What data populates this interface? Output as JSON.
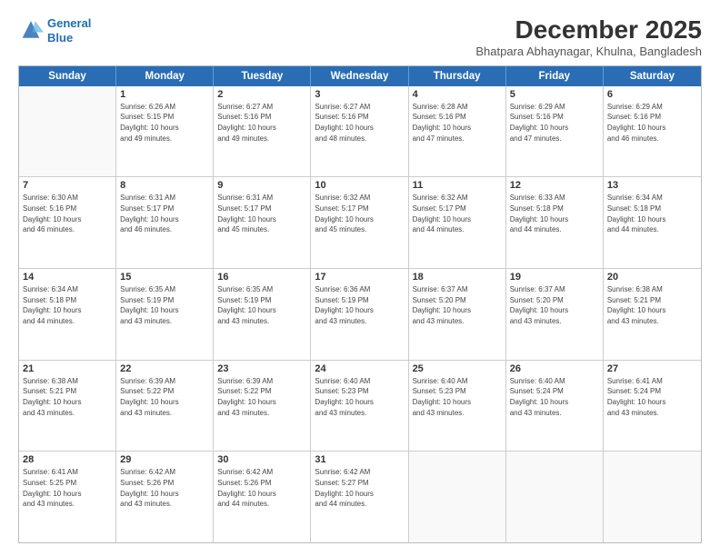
{
  "logo": {
    "line1": "General",
    "line2": "Blue"
  },
  "title": "December 2025",
  "location": "Bhatpara Abhaynagar, Khulna, Bangladesh",
  "weekdays": [
    "Sunday",
    "Monday",
    "Tuesday",
    "Wednesday",
    "Thursday",
    "Friday",
    "Saturday"
  ],
  "weeks": [
    [
      {
        "day": "",
        "info": ""
      },
      {
        "day": "1",
        "info": "Sunrise: 6:26 AM\nSunset: 5:15 PM\nDaylight: 10 hours\nand 49 minutes."
      },
      {
        "day": "2",
        "info": "Sunrise: 6:27 AM\nSunset: 5:16 PM\nDaylight: 10 hours\nand 49 minutes."
      },
      {
        "day": "3",
        "info": "Sunrise: 6:27 AM\nSunset: 5:16 PM\nDaylight: 10 hours\nand 48 minutes."
      },
      {
        "day": "4",
        "info": "Sunrise: 6:28 AM\nSunset: 5:16 PM\nDaylight: 10 hours\nand 47 minutes."
      },
      {
        "day": "5",
        "info": "Sunrise: 6:29 AM\nSunset: 5:16 PM\nDaylight: 10 hours\nand 47 minutes."
      },
      {
        "day": "6",
        "info": "Sunrise: 6:29 AM\nSunset: 5:16 PM\nDaylight: 10 hours\nand 46 minutes."
      }
    ],
    [
      {
        "day": "7",
        "info": "Sunrise: 6:30 AM\nSunset: 5:16 PM\nDaylight: 10 hours\nand 46 minutes."
      },
      {
        "day": "8",
        "info": "Sunrise: 6:31 AM\nSunset: 5:17 PM\nDaylight: 10 hours\nand 46 minutes."
      },
      {
        "day": "9",
        "info": "Sunrise: 6:31 AM\nSunset: 5:17 PM\nDaylight: 10 hours\nand 45 minutes."
      },
      {
        "day": "10",
        "info": "Sunrise: 6:32 AM\nSunset: 5:17 PM\nDaylight: 10 hours\nand 45 minutes."
      },
      {
        "day": "11",
        "info": "Sunrise: 6:32 AM\nSunset: 5:17 PM\nDaylight: 10 hours\nand 44 minutes."
      },
      {
        "day": "12",
        "info": "Sunrise: 6:33 AM\nSunset: 5:18 PM\nDaylight: 10 hours\nand 44 minutes."
      },
      {
        "day": "13",
        "info": "Sunrise: 6:34 AM\nSunset: 5:18 PM\nDaylight: 10 hours\nand 44 minutes."
      }
    ],
    [
      {
        "day": "14",
        "info": "Sunrise: 6:34 AM\nSunset: 5:18 PM\nDaylight: 10 hours\nand 44 minutes."
      },
      {
        "day": "15",
        "info": "Sunrise: 6:35 AM\nSunset: 5:19 PM\nDaylight: 10 hours\nand 43 minutes."
      },
      {
        "day": "16",
        "info": "Sunrise: 6:35 AM\nSunset: 5:19 PM\nDaylight: 10 hours\nand 43 minutes."
      },
      {
        "day": "17",
        "info": "Sunrise: 6:36 AM\nSunset: 5:19 PM\nDaylight: 10 hours\nand 43 minutes."
      },
      {
        "day": "18",
        "info": "Sunrise: 6:37 AM\nSunset: 5:20 PM\nDaylight: 10 hours\nand 43 minutes."
      },
      {
        "day": "19",
        "info": "Sunrise: 6:37 AM\nSunset: 5:20 PM\nDaylight: 10 hours\nand 43 minutes."
      },
      {
        "day": "20",
        "info": "Sunrise: 6:38 AM\nSunset: 5:21 PM\nDaylight: 10 hours\nand 43 minutes."
      }
    ],
    [
      {
        "day": "21",
        "info": "Sunrise: 6:38 AM\nSunset: 5:21 PM\nDaylight: 10 hours\nand 43 minutes."
      },
      {
        "day": "22",
        "info": "Sunrise: 6:39 AM\nSunset: 5:22 PM\nDaylight: 10 hours\nand 43 minutes."
      },
      {
        "day": "23",
        "info": "Sunrise: 6:39 AM\nSunset: 5:22 PM\nDaylight: 10 hours\nand 43 minutes."
      },
      {
        "day": "24",
        "info": "Sunrise: 6:40 AM\nSunset: 5:23 PM\nDaylight: 10 hours\nand 43 minutes."
      },
      {
        "day": "25",
        "info": "Sunrise: 6:40 AM\nSunset: 5:23 PM\nDaylight: 10 hours\nand 43 minutes."
      },
      {
        "day": "26",
        "info": "Sunrise: 6:40 AM\nSunset: 5:24 PM\nDaylight: 10 hours\nand 43 minutes."
      },
      {
        "day": "27",
        "info": "Sunrise: 6:41 AM\nSunset: 5:24 PM\nDaylight: 10 hours\nand 43 minutes."
      }
    ],
    [
      {
        "day": "28",
        "info": "Sunrise: 6:41 AM\nSunset: 5:25 PM\nDaylight: 10 hours\nand 43 minutes."
      },
      {
        "day": "29",
        "info": "Sunrise: 6:42 AM\nSunset: 5:26 PM\nDaylight: 10 hours\nand 43 minutes."
      },
      {
        "day": "30",
        "info": "Sunrise: 6:42 AM\nSunset: 5:26 PM\nDaylight: 10 hours\nand 44 minutes."
      },
      {
        "day": "31",
        "info": "Sunrise: 6:42 AM\nSunset: 5:27 PM\nDaylight: 10 hours\nand 44 minutes."
      },
      {
        "day": "",
        "info": ""
      },
      {
        "day": "",
        "info": ""
      },
      {
        "day": "",
        "info": ""
      }
    ]
  ]
}
